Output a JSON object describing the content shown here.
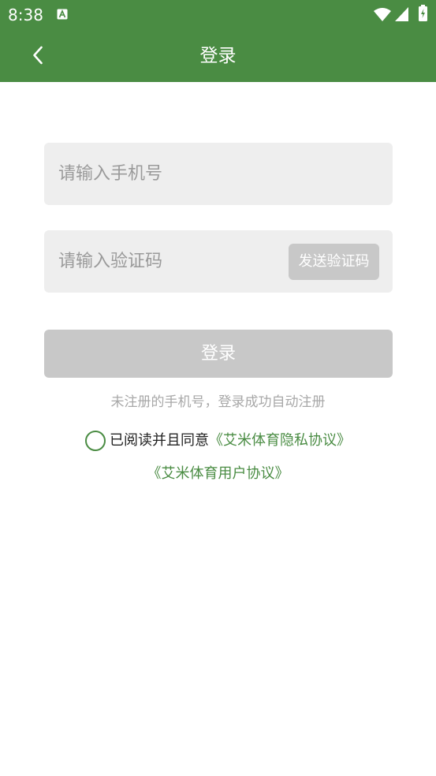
{
  "status_bar": {
    "time": "8:38"
  },
  "header": {
    "title": "登录"
  },
  "form": {
    "phone_placeholder": "请输入手机号",
    "code_placeholder": "请输入验证码",
    "send_code_label": "发送验证码",
    "login_label": "登录"
  },
  "hint": "未注册的手机号，登录成功自动注册",
  "agreement": {
    "prefix": "已阅读并且同意",
    "privacy_link": "《艾米体育隐私协议》",
    "user_link": "《艾米体育用户协议》",
    "checked": false
  },
  "colors": {
    "accent": "#4a8c43",
    "disabled_button": "#c8c8c8",
    "field_background": "#eeeeee"
  },
  "icons": {
    "back": "chevron-left-icon",
    "wifi": "wifi-icon",
    "signal": "signal-icon",
    "battery": "battery-icon",
    "notification": "a-notification-icon"
  }
}
